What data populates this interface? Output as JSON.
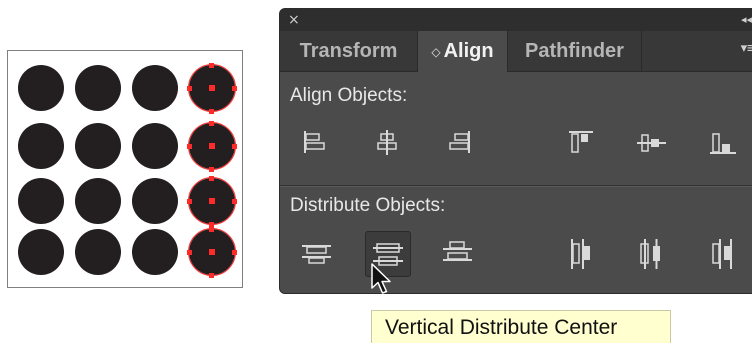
{
  "panel": {
    "close_glyph": "×",
    "collapse_glyph": "◂◂",
    "menu_glyph": "▾≡",
    "tabs": [
      {
        "label": "Transform",
        "active": false
      },
      {
        "label": "Align",
        "active": true,
        "arrows": "◇"
      },
      {
        "label": "Pathfinder",
        "active": false
      }
    ],
    "sections": {
      "align_objects": {
        "title": "Align Objects:",
        "buttons": [
          {
            "name": "horizontal-align-left",
            "icon": "align-left-icon"
          },
          {
            "name": "horizontal-align-center",
            "icon": "align-hcenter-icon"
          },
          {
            "name": "horizontal-align-right",
            "icon": "align-right-icon"
          },
          {
            "name": "vertical-align-top",
            "icon": "align-top-icon"
          },
          {
            "name": "vertical-align-center",
            "icon": "align-vcenter-icon"
          },
          {
            "name": "vertical-align-bottom",
            "icon": "align-bottom-icon"
          }
        ]
      },
      "distribute_objects": {
        "title": "Distribute Objects:",
        "buttons": [
          {
            "name": "vertical-distribute-top",
            "icon": "distribute-top-icon"
          },
          {
            "name": "vertical-distribute-center",
            "icon": "distribute-vcenter-icon",
            "pressed": true
          },
          {
            "name": "vertical-distribute-bottom",
            "icon": "distribute-bottom-icon"
          },
          {
            "name": "horizontal-distribute-left",
            "icon": "distribute-left-icon"
          },
          {
            "name": "horizontal-distribute-center",
            "icon": "distribute-hcenter-icon"
          },
          {
            "name": "horizontal-distribute-right",
            "icon": "distribute-right-icon"
          }
        ]
      }
    }
  },
  "tooltip": {
    "text": "Vertical Distribute Center"
  },
  "artboard": {
    "rows": 4,
    "cols": 4,
    "selected_column": 4,
    "dot_color": "#231f20",
    "selection_color": "#ff2a2a"
  },
  "colors": {
    "panel_bg": "#4b4b4b",
    "tabbar_bg": "#383838",
    "titlebar_bg": "#2e2e2e",
    "tooltip_bg": "#ffffd0"
  }
}
